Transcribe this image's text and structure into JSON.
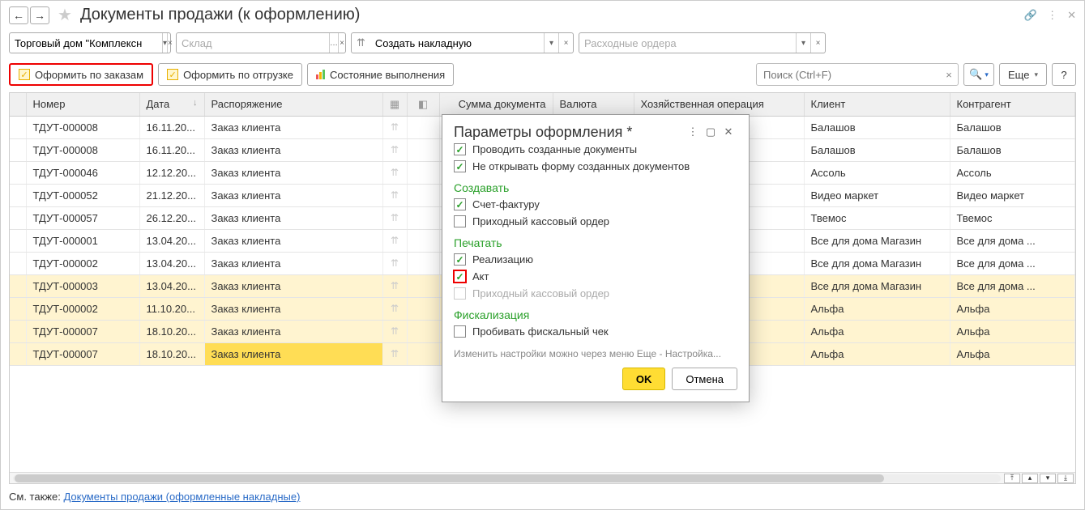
{
  "title": "Документы продажи (к оформлению)",
  "filters": {
    "org": "Торговый дом \"Комплексн",
    "warehouse_placeholder": "Склад",
    "create_waybill": "Создать накладную",
    "expense_orders_placeholder": "Расходные ордера"
  },
  "actions": {
    "by_orders": "Оформить по заказам",
    "by_shipment": "Оформить по отгрузке",
    "state": "Состояние выполнения",
    "search_placeholder": "Поиск (Ctrl+F)",
    "more": "Еще",
    "help": "?"
  },
  "columns": {
    "number": "Номер",
    "date": "Дата",
    "order": "Распоряжение",
    "sum": "Сумма документа",
    "currency": "Валюта",
    "operation": "Хозяйственная операция",
    "client": "Клиент",
    "counterparty": "Контрагент"
  },
  "rows": [
    {
      "num": "ТДУТ-000008",
      "date": "16.11.20...",
      "order": "Заказ клиента",
      "client": "Балашов",
      "cp": "Балашов",
      "hl": false
    },
    {
      "num": "ТДУТ-000008",
      "date": "16.11.20...",
      "order": "Заказ клиента",
      "client": "Балашов",
      "cp": "Балашов",
      "hl": false
    },
    {
      "num": "ТДУТ-000046",
      "date": "12.12.20...",
      "order": "Заказ клиента",
      "client": "Ассоль",
      "cp": "Ассоль",
      "hl": false
    },
    {
      "num": "ТДУТ-000052",
      "date": "21.12.20...",
      "order": "Заказ клиента",
      "client": "Видео маркет",
      "cp": "Видео маркет",
      "hl": false
    },
    {
      "num": "ТДУТ-000057",
      "date": "26.12.20...",
      "order": "Заказ клиента",
      "client": "Твемос",
      "cp": "Твемос",
      "hl": false
    },
    {
      "num": "ТДУТ-000001",
      "date": "13.04.20...",
      "order": "Заказ клиента",
      "client": "Все для дома Магазин",
      "cp": "Все для дома ...",
      "hl": false
    },
    {
      "num": "ТДУТ-000002",
      "date": "13.04.20...",
      "order": "Заказ клиента",
      "client": "Все для дома Магазин",
      "cp": "Все для дома ...",
      "hl": false
    },
    {
      "num": "ТДУТ-000003",
      "date": "13.04.20...",
      "order": "Заказ клиента",
      "client": "Все для дома Магазин",
      "cp": "Все для дома ...",
      "hl": true
    },
    {
      "num": "ТДУТ-000002",
      "date": "11.10.20...",
      "order": "Заказ клиента",
      "client": "Альфа",
      "cp": "Альфа",
      "hl": true
    },
    {
      "num": "ТДУТ-000007",
      "date": "18.10.20...",
      "order": "Заказ клиента",
      "client": "Альфа",
      "cp": "Альфа",
      "hl": true
    },
    {
      "num": "ТДУТ-000007",
      "date": "18.10.20...",
      "order": "Заказ клиента",
      "client": "Альфа",
      "cp": "Альфа",
      "hl": true,
      "active": true
    }
  ],
  "footer": {
    "prefix": "См. также: ",
    "link": "Документы продажи (оформленные накладные)"
  },
  "dialog": {
    "title": "Параметры оформления *",
    "post_created": "Проводить созданные документы",
    "dont_open": "Не открывать форму созданных документов",
    "section_create": "Создавать",
    "invoice": "Счет-фактуру",
    "cash_order": "Приходный кассовый ордер",
    "section_print": "Печатать",
    "realization": "Реализацию",
    "act": "Акт",
    "cash_order2": "Приходный кассовый ордер",
    "section_fiscal": "Фискализация",
    "fiscal_check": "Пробивать фискальный чек",
    "hint": "Изменить настройки можно через меню Еще - Настройка...",
    "ok": "OK",
    "cancel": "Отмена"
  }
}
